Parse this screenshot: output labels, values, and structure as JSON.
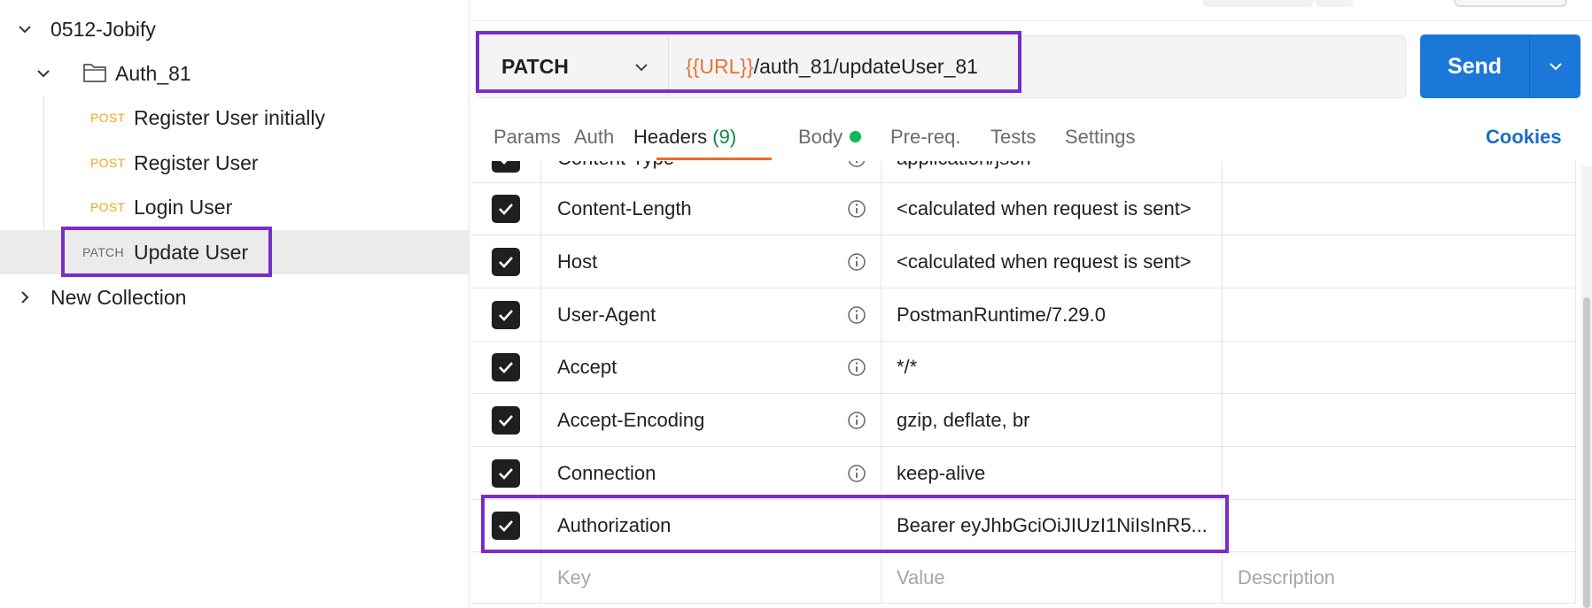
{
  "sidebar": {
    "collection": {
      "name": "0512-Jobify",
      "expanded": true
    },
    "folder": {
      "name": "Auth_81",
      "expanded": true
    },
    "requests": [
      {
        "method": "POST",
        "name": "Register User initially"
      },
      {
        "method": "POST",
        "name": "Register User"
      },
      {
        "method": "POST",
        "name": "Login User"
      },
      {
        "method": "PATCH",
        "name": "Update User",
        "selected": true
      }
    ],
    "other_collection": {
      "name": "New Collection",
      "expanded": false
    }
  },
  "request": {
    "method": "PATCH",
    "url_variable": "{{URL}}",
    "url_path": "/auth_81/updateUser_81",
    "send_label": "Send"
  },
  "tabs": {
    "params": "Params",
    "auth": "Auth",
    "headers": "Headers",
    "headers_count": "(9)",
    "body": "Body",
    "prereq": "Pre-req.",
    "tests": "Tests",
    "settings": "Settings",
    "cookies": "Cookies",
    "active": "Headers"
  },
  "headers_table": {
    "rows": [
      {
        "key": "Content-Type",
        "value": "application/json",
        "checked": true
      },
      {
        "key": "Content-Length",
        "value": "<calculated when request is sent>",
        "checked": true
      },
      {
        "key": "Host",
        "value": "<calculated when request is sent>",
        "checked": true
      },
      {
        "key": "User-Agent",
        "value": "PostmanRuntime/7.29.0",
        "checked": true
      },
      {
        "key": "Accept",
        "value": "*/*",
        "checked": true
      },
      {
        "key": "Accept-Encoding",
        "value": "gzip, deflate, br",
        "checked": true
      },
      {
        "key": "Connection",
        "value": "keep-alive",
        "checked": true
      },
      {
        "key": "Authorization",
        "value": "Bearer eyJhbGciOiJIUzI1NiIsInR5...",
        "checked": true
      }
    ],
    "placeholders": {
      "key": "Key",
      "value": "Value",
      "description": "Description"
    }
  },
  "colors": {
    "highlight": "#7a2cc8",
    "send_button": "#1b78d8",
    "post_method": "#e8a921",
    "url_variable": "#e5743b",
    "active_tab_underline": "#f06b2b",
    "headers_count": "#0e8a3f",
    "cookies_link": "#1b6ec2"
  }
}
